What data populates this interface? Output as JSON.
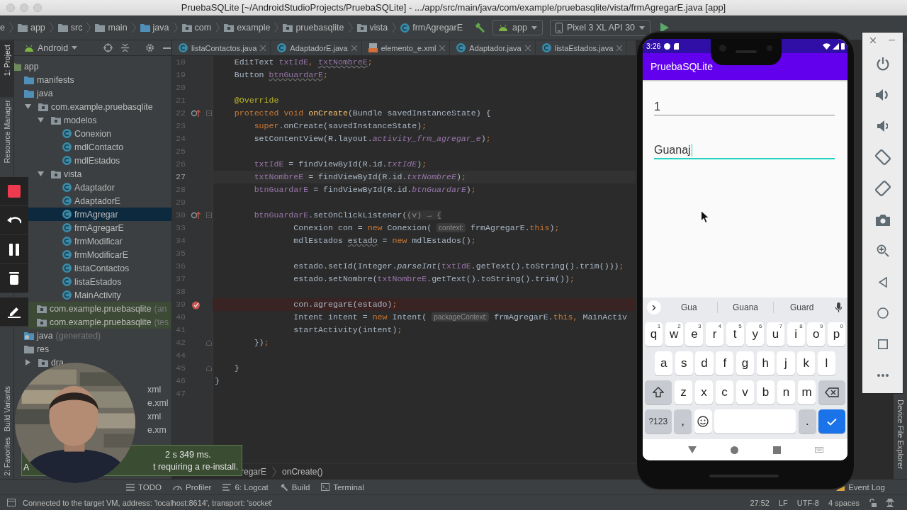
{
  "window": {
    "title": "PruebaSQLite [~/AndroidStudioProjects/PruebaSQLite] - .../app/src/main/java/com/example/pruebasqlite/vista/frmAgregarE.java [app]"
  },
  "nav_bar": {
    "crumbs": [
      {
        "label": "e",
        "kind": "fragment"
      },
      {
        "label": "app",
        "kind": "folder"
      },
      {
        "label": "src",
        "kind": "folder"
      },
      {
        "label": "main",
        "kind": "folder"
      },
      {
        "label": "java",
        "kind": "source"
      },
      {
        "label": "com",
        "kind": "package"
      },
      {
        "label": "example",
        "kind": "package"
      },
      {
        "label": "pruebasqlite",
        "kind": "package"
      },
      {
        "label": "vista",
        "kind": "package"
      },
      {
        "label": "frmAgregarE",
        "kind": "class"
      }
    ],
    "run_config": "app",
    "device": "Pixel 3 XL API 30"
  },
  "left_tool_tabs": [
    {
      "label": "1: Project",
      "kind": "top",
      "selected": true
    },
    {
      "label": "Resource Manager",
      "kind": "top",
      "selected": false
    },
    {
      "label": "Build Variants",
      "kind": "bottom",
      "selected": false
    },
    {
      "label": "2: Favorites",
      "kind": "bottom",
      "selected": false
    }
  ],
  "project_panel": {
    "view": "Android",
    "tree": [
      {
        "label": "app",
        "kind": "module",
        "selected": false,
        "children": [
          {
            "label": "manifests",
            "kind": "source",
            "selected": false
          },
          {
            "label": "java",
            "kind": "source",
            "selected": false,
            "children": [
              {
                "label": "com.example.pruebasqlite",
                "kind": "package",
                "expanded": true,
                "selected": false,
                "children": [
                  {
                    "label": "modelos",
                    "kind": "package",
                    "expanded": true,
                    "selected": false,
                    "children": [
                      {
                        "label": "Conexion",
                        "kind": "class",
                        "selected": false
                      },
                      {
                        "label": "mdlContacto",
                        "kind": "class",
                        "selected": false
                      },
                      {
                        "label": "mdlEstados",
                        "kind": "class",
                        "selected": false
                      }
                    ]
                  },
                  {
                    "label": "vista",
                    "kind": "package",
                    "expanded": true,
                    "selected": false,
                    "children": [
                      {
                        "label": "Adaptador",
                        "kind": "class",
                        "selected": false
                      },
                      {
                        "label": "AdaptadorE",
                        "kind": "class",
                        "selected": false
                      },
                      {
                        "label": "frmAgregar",
                        "kind": "class",
                        "selected": true
                      },
                      {
                        "label": "frmAgregarE",
                        "kind": "class",
                        "selected": false
                      },
                      {
                        "label": "frmModificar",
                        "kind": "class",
                        "selected": false
                      },
                      {
                        "label": "frmModificarE",
                        "kind": "class",
                        "selected": false
                      },
                      {
                        "label": "listaContactos",
                        "kind": "class",
                        "selected": false
                      },
                      {
                        "label": "listaEstados",
                        "kind": "class",
                        "selected": false
                      },
                      {
                        "label": "MainActivity",
                        "kind": "class",
                        "selected": false
                      }
                    ]
                  }
                ]
              },
              {
                "label": "com.example.pruebasqlite",
                "suffix": "(an",
                "kind": "test-package",
                "selected": false
              },
              {
                "label": "com.example.pruebasqlite",
                "suffix": "(tes",
                "kind": "test-package",
                "selected": false
              }
            ]
          },
          {
            "label": "java",
            "suffix": "(generated)",
            "kind": "generated",
            "selected": false
          },
          {
            "label": "res",
            "kind": "folder",
            "selected": false,
            "children": [
              {
                "label": "dra",
                "kind": "package",
                "expanded": false,
                "selected": false
              }
            ]
          }
        ]
      }
    ],
    "partly_covered_rows": [
      "xml",
      "e.xml",
      "xml",
      "e.xm"
    ]
  },
  "editor": {
    "tabs": [
      {
        "label": "listaContactos.java",
        "kind": "class"
      },
      {
        "label": "AdaptadorE.java",
        "kind": "class"
      },
      {
        "label": "elemento_e.xml",
        "kind": "layout"
      },
      {
        "label": "Adaptador.java",
        "kind": "class"
      },
      {
        "label": "listaEstados.java",
        "kind": "class"
      }
    ],
    "lines": [
      {
        "number": "18",
        "kind": "normal",
        "tokens": [
          {
            "text": "    EditText ",
            "kind": "plain"
          },
          {
            "text": "txtIdE",
            "kind": "field"
          },
          {
            "text": ", ",
            "kind": "keyword"
          },
          {
            "text": "txtNombreE",
            "kind": "field-warning"
          },
          {
            "text": ";",
            "kind": "keyword"
          }
        ]
      },
      {
        "number": "19",
        "kind": "normal",
        "tokens": [
          {
            "text": "    Button ",
            "kind": "plain"
          },
          {
            "text": "btnGuardarE",
            "kind": "field-warning"
          },
          {
            "text": ";",
            "kind": "keyword"
          }
        ]
      },
      {
        "number": "20",
        "kind": "normal"
      },
      {
        "number": "21",
        "kind": "normal",
        "tokens": [
          {
            "text": "    @Override",
            "kind": "annotation"
          }
        ]
      },
      {
        "number": "22",
        "kind": "normal",
        "gutter_icon": {
          "kind": "override"
        },
        "fold_marker": {
          "kind": "start"
        },
        "tokens": [
          {
            "text": "    protected void ",
            "kind": "keyword"
          },
          {
            "text": "onCreate",
            "kind": "method"
          },
          {
            "text": "(Bundle savedInstanceState) {",
            "kind": "plain"
          }
        ]
      },
      {
        "number": "23",
        "kind": "normal",
        "tokens": [
          {
            "text": "        super",
            "kind": "keyword"
          },
          {
            "text": ".onCreate(savedInstanceState)",
            "kind": "plain"
          },
          {
            "text": ";",
            "kind": "keyword"
          }
        ]
      },
      {
        "number": "24",
        "kind": "normal",
        "tokens": [
          {
            "text": "        setContentView(R.layout.",
            "kind": "plain"
          },
          {
            "text": "activity_frm_agregar_e",
            "kind": "field-italic"
          },
          {
            "text": ")",
            "kind": "plain"
          },
          {
            "text": ";",
            "kind": "keyword"
          }
        ]
      },
      {
        "number": "25",
        "kind": "normal"
      },
      {
        "number": "26",
        "kind": "normal",
        "tokens": [
          {
            "text": "        txtIdE",
            "kind": "field"
          },
          {
            "text": " = findViewById(R.id.",
            "kind": "plain"
          },
          {
            "text": "txtIdE",
            "kind": "field-italic"
          },
          {
            "text": ")",
            "kind": "plain"
          },
          {
            "text": ";",
            "kind": "keyword"
          }
        ]
      },
      {
        "number": "27",
        "kind": "current",
        "tokens": [
          {
            "text": "        txtNombreE",
            "kind": "field"
          },
          {
            "text": " = findViewById(R.id.",
            "kind": "plain"
          },
          {
            "text": "txtNombreE",
            "kind": "field-italic"
          },
          {
            "text": ")",
            "kind": "plain"
          },
          {
            "text": ";",
            "kind": "keyword"
          }
        ]
      },
      {
        "number": "28",
        "kind": "normal",
        "tokens": [
          {
            "text": "        btnGuardarE",
            "kind": "field"
          },
          {
            "text": " = findViewById(R.id.",
            "kind": "plain"
          },
          {
            "text": "btnGuardarE",
            "kind": "field-italic"
          },
          {
            "text": ")",
            "kind": "plain"
          },
          {
            "text": ";",
            "kind": "keyword"
          }
        ]
      },
      {
        "number": "29",
        "kind": "normal"
      },
      {
        "number": "30",
        "kind": "normal",
        "gutter_icon": {
          "kind": "override"
        },
        "fold_marker": {
          "kind": "start"
        },
        "tokens": [
          {
            "text": "        btnGuardarE",
            "kind": "field"
          },
          {
            "text": ".setOnClickListener(",
            "kind": "plain"
          },
          {
            "text": "(v) → {",
            "kind": "folded"
          }
        ]
      },
      {
        "number": "33",
        "kind": "normal",
        "tokens": [
          {
            "text": "                Conexion con = ",
            "kind": "plain"
          },
          {
            "text": "new ",
            "kind": "keyword"
          },
          {
            "text": "Conexion( ",
            "kind": "plain"
          },
          {
            "text": "context:",
            "kind": "hint"
          },
          {
            "text": " frmAgregarE.",
            "kind": "plain"
          },
          {
            "text": "this",
            "kind": "keyword"
          },
          {
            "text": ")",
            "kind": "plain"
          },
          {
            "text": ";",
            "kind": "keyword"
          }
        ]
      },
      {
        "number": "34",
        "kind": "normal",
        "tokens": [
          {
            "text": "                mdlEstados ",
            "kind": "plain"
          },
          {
            "text": "estado",
            "kind": "plain-warning"
          },
          {
            "text": " = ",
            "kind": "plain"
          },
          {
            "text": "new ",
            "kind": "keyword"
          },
          {
            "text": "mdlEstados()",
            "kind": "plain"
          },
          {
            "text": ";",
            "kind": "keyword"
          }
        ]
      },
      {
        "number": "35",
        "kind": "normal"
      },
      {
        "number": "36",
        "kind": "normal",
        "tokens": [
          {
            "text": "                estado.setId(Integer.",
            "kind": "plain"
          },
          {
            "text": "parseInt",
            "kind": "italic"
          },
          {
            "text": "(",
            "kind": "plain"
          },
          {
            "text": "txtIdE",
            "kind": "field"
          },
          {
            "text": ".getText().toString().trim()))",
            "kind": "plain"
          },
          {
            "text": ";",
            "kind": "keyword"
          }
        ]
      },
      {
        "number": "37",
        "kind": "normal",
        "tokens": [
          {
            "text": "                estado.setNombre(",
            "kind": "plain"
          },
          {
            "text": "txtNombreE",
            "kind": "field"
          },
          {
            "text": ".getText().toString().trim())",
            "kind": "plain"
          },
          {
            "text": ";",
            "kind": "keyword"
          }
        ]
      },
      {
        "number": "38",
        "kind": "normal"
      },
      {
        "number": "39",
        "kind": "breakpoint",
        "tokens": [
          {
            "text": "                con.agregarE(estado)",
            "kind": "plain"
          },
          {
            "text": ";",
            "kind": "keyword"
          }
        ]
      },
      {
        "number": "40",
        "kind": "normal",
        "tokens": [
          {
            "text": "                Intent intent = ",
            "kind": "plain"
          },
          {
            "text": "new ",
            "kind": "keyword"
          },
          {
            "text": "Intent( ",
            "kind": "plain"
          },
          {
            "text": "packageContext:",
            "kind": "hint"
          },
          {
            "text": " frmAgregarE.",
            "kind": "plain"
          },
          {
            "text": "this",
            "kind": "keyword"
          },
          {
            "text": ", ",
            "kind": "keyword"
          },
          {
            "text": "MainActiv",
            "kind": "plain"
          }
        ]
      },
      {
        "number": "41",
        "kind": "normal",
        "tokens": [
          {
            "text": "                startActivity(intent)",
            "kind": "plain"
          },
          {
            "text": ";",
            "kind": "keyword"
          }
        ]
      },
      {
        "number": "42",
        "kind": "normal",
        "fold_marker": {
          "kind": "end"
        },
        "tokens": [
          {
            "text": "        })",
            "kind": "plain"
          },
          {
            "text": ";",
            "kind": "keyword"
          }
        ]
      },
      {
        "number": "44",
        "kind": "normal"
      },
      {
        "number": "45",
        "kind": "normal",
        "fold_marker": {
          "kind": "end"
        },
        "tokens": [
          {
            "text": "    }",
            "kind": "plain"
          }
        ]
      },
      {
        "number": "46",
        "kind": "normal",
        "tokens": [
          {
            "text": "}",
            "kind": "plain"
          }
        ]
      },
      {
        "number": "47",
        "kind": "normal"
      }
    ],
    "breadcrumb": [
      "regarE",
      "onCreate()"
    ]
  },
  "notification": {
    "lead": "A",
    "lines": [
      "2 s 349 ms.",
      "t requiring a re-install."
    ]
  },
  "bottom_tools": [
    {
      "label": "TODO",
      "kind": "todo"
    },
    {
      "label": "Profiler",
      "kind": "profiler"
    },
    {
      "label": "6: Logcat",
      "kind": "logcat"
    },
    {
      "label": "Build",
      "kind": "build"
    },
    {
      "label": "Terminal",
      "kind": "terminal"
    }
  ],
  "event_log": "Event Log",
  "right_tool_tabs": [
    "Device File Explorer"
  ],
  "status_bar": {
    "message": "Connected to the target VM, address: 'localhost:8614', transport: 'socket'",
    "position": "27:52",
    "line_ending": "LF",
    "encoding": "UTF-8",
    "indent": "4 spaces"
  },
  "emulator": {
    "clock": "3:26",
    "app_title": "PruebaSQLite",
    "fields": [
      {
        "value": "1",
        "focused": false
      },
      {
        "value": "Guanaj",
        "focused": true
      }
    ],
    "keyboard": {
      "suggestions": [
        "Gua",
        "Guana",
        "Guard"
      ],
      "rows": [
        {
          "keys": [
            {
              "kind": "letter",
              "label": "q",
              "hint": "1"
            },
            {
              "kind": "letter",
              "label": "w",
              "hint": "2"
            },
            {
              "kind": "letter",
              "label": "e",
              "hint": "3"
            },
            {
              "kind": "letter",
              "label": "r",
              "hint": "4"
            },
            {
              "kind": "letter",
              "label": "t",
              "hint": "5"
            },
            {
              "kind": "letter",
              "label": "y",
              "hint": "6"
            },
            {
              "kind": "letter",
              "label": "u",
              "hint": "7"
            },
            {
              "kind": "letter",
              "label": "i",
              "hint": "8"
            },
            {
              "kind": "letter",
              "label": "o",
              "hint": "9"
            },
            {
              "kind": "letter",
              "label": "p",
              "hint": "0"
            }
          ]
        },
        {
          "keys": [
            {
              "kind": "letter",
              "label": "a"
            },
            {
              "kind": "letter",
              "label": "s"
            },
            {
              "kind": "letter",
              "label": "d"
            },
            {
              "kind": "letter",
              "label": "f"
            },
            {
              "kind": "letter",
              "label": "g"
            },
            {
              "kind": "letter",
              "label": "h"
            },
            {
              "kind": "letter",
              "label": "j"
            },
            {
              "kind": "letter",
              "label": "k"
            },
            {
              "kind": "letter",
              "label": "l"
            }
          ]
        },
        {
          "keys": [
            {
              "kind": "shift"
            },
            {
              "kind": "letter",
              "label": "z"
            },
            {
              "kind": "letter",
              "label": "x"
            },
            {
              "kind": "letter",
              "label": "c"
            },
            {
              "kind": "letter",
              "label": "v"
            },
            {
              "kind": "letter",
              "label": "b"
            },
            {
              "kind": "letter",
              "label": "n"
            },
            {
              "kind": "letter",
              "label": "m"
            },
            {
              "kind": "backspace"
            }
          ]
        },
        {
          "keys": [
            {
              "kind": "symbols",
              "label": "?123"
            },
            {
              "kind": "punct",
              "label": ","
            },
            {
              "kind": "emoji"
            },
            {
              "kind": "space"
            },
            {
              "kind": "punct",
              "label": "."
            },
            {
              "kind": "enter"
            }
          ]
        }
      ]
    }
  }
}
